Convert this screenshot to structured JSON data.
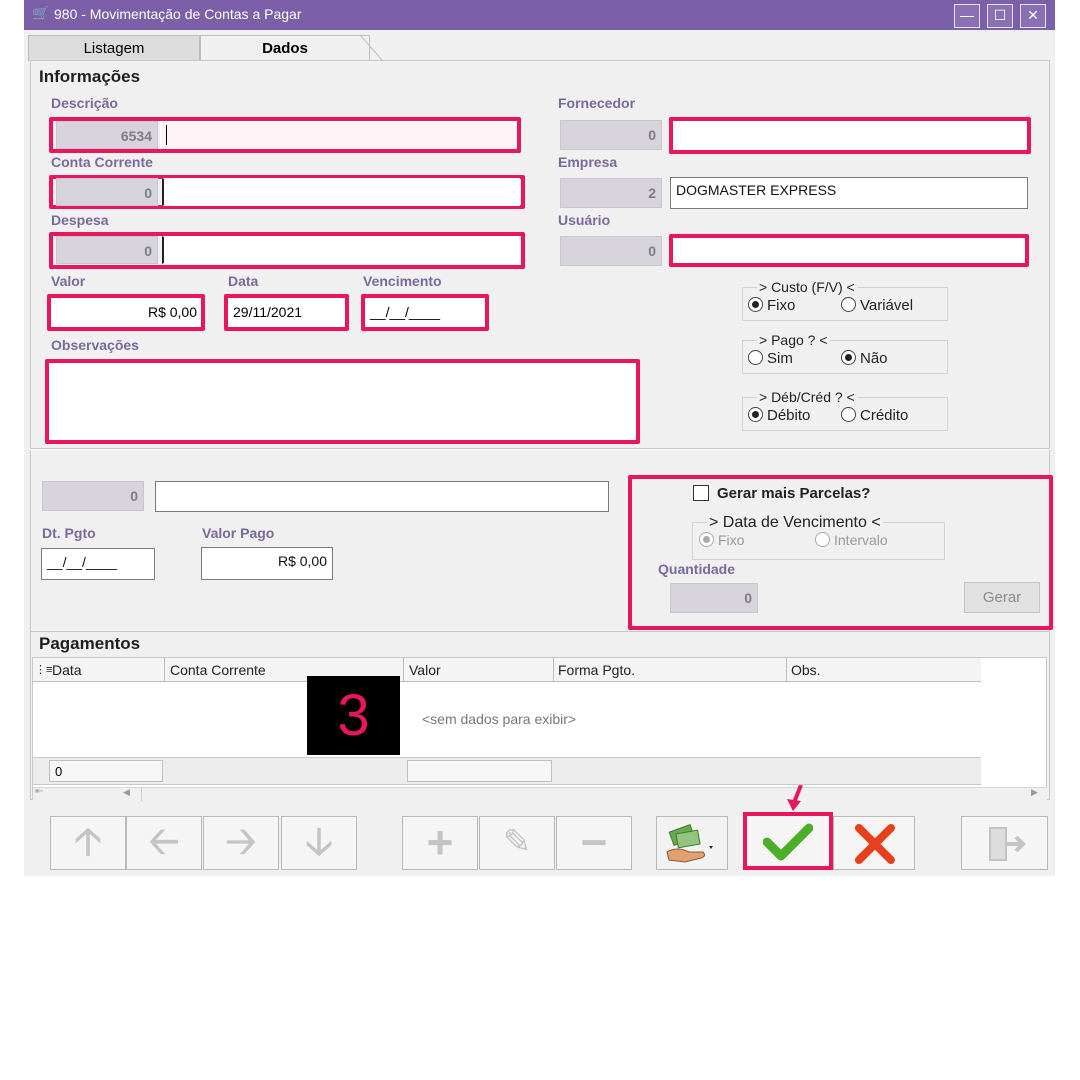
{
  "window": {
    "title": "980 - Movimentação de Contas a Pagar"
  },
  "tabs": {
    "list_label": "Listagem",
    "data_label": "Dados"
  },
  "info": {
    "section_title": "Informações",
    "descricao": {
      "label": "Descrição",
      "code": "6534",
      "value": ""
    },
    "conta_corrente": {
      "label": "Conta Corrente",
      "code": "0",
      "value": ""
    },
    "despesa": {
      "label": "Despesa",
      "code": "0",
      "value": ""
    },
    "fornecedor": {
      "label": "Fornecedor",
      "code": "0",
      "value": ""
    },
    "empresa": {
      "label": "Empresa",
      "code": "2",
      "value": "DOGMASTER EXPRESS"
    },
    "usuario": {
      "label": "Usuário",
      "code": "0",
      "value": ""
    },
    "valor": {
      "label": "Valor",
      "value": "R$ 0,00"
    },
    "data": {
      "label": "Data",
      "value": "29/11/2021"
    },
    "vencimento": {
      "label": "Vencimento",
      "value": "__/__/____"
    },
    "observacoes": {
      "label": "Observações",
      "value": ""
    }
  },
  "radios": {
    "custo": {
      "caption": "> Custo (F/V) <",
      "opt1": "Fixo",
      "opt2": "Variável",
      "selected": "Fixo"
    },
    "pago": {
      "caption": "> Pago ? <",
      "opt1": "Sim",
      "opt2": "Não",
      "selected": "Não"
    },
    "debcred": {
      "caption": "> Déb/Créd ? <",
      "opt1": "Débito",
      "opt2": "Crédito",
      "selected": "Débito"
    }
  },
  "payment": {
    "code": "0",
    "desc": "",
    "dt_pgto_label": "Dt. Pgto",
    "dt_pgto_value": "__/__/____",
    "valor_pago_label": "Valor Pago",
    "valor_pago_value": "R$ 0,00"
  },
  "parcelas": {
    "checkbox_label": "Gerar mais Parcelas?",
    "venc_caption": "> Data de Vencimento <",
    "opt1": "Fixo",
    "opt2": "Intervalo",
    "quantidade_label": "Quantidade",
    "quantidade_value": "0",
    "gerar_label": "Gerar"
  },
  "pagamentos": {
    "section_title": "Pagamentos",
    "columns": [
      "Data",
      "Conta Corrente",
      "Valor",
      "Forma Pgto.",
      "Obs."
    ],
    "empty_text": "<sem dados para exibir>",
    "footer_count": "0"
  },
  "overlay": {
    "step_number": "3"
  },
  "colors": {
    "titlebar": "#7b5fa8",
    "highlight": "#e8175d",
    "label": "#7a6a9c",
    "confirm": "#4caf28",
    "cancel": "#e8401c"
  }
}
